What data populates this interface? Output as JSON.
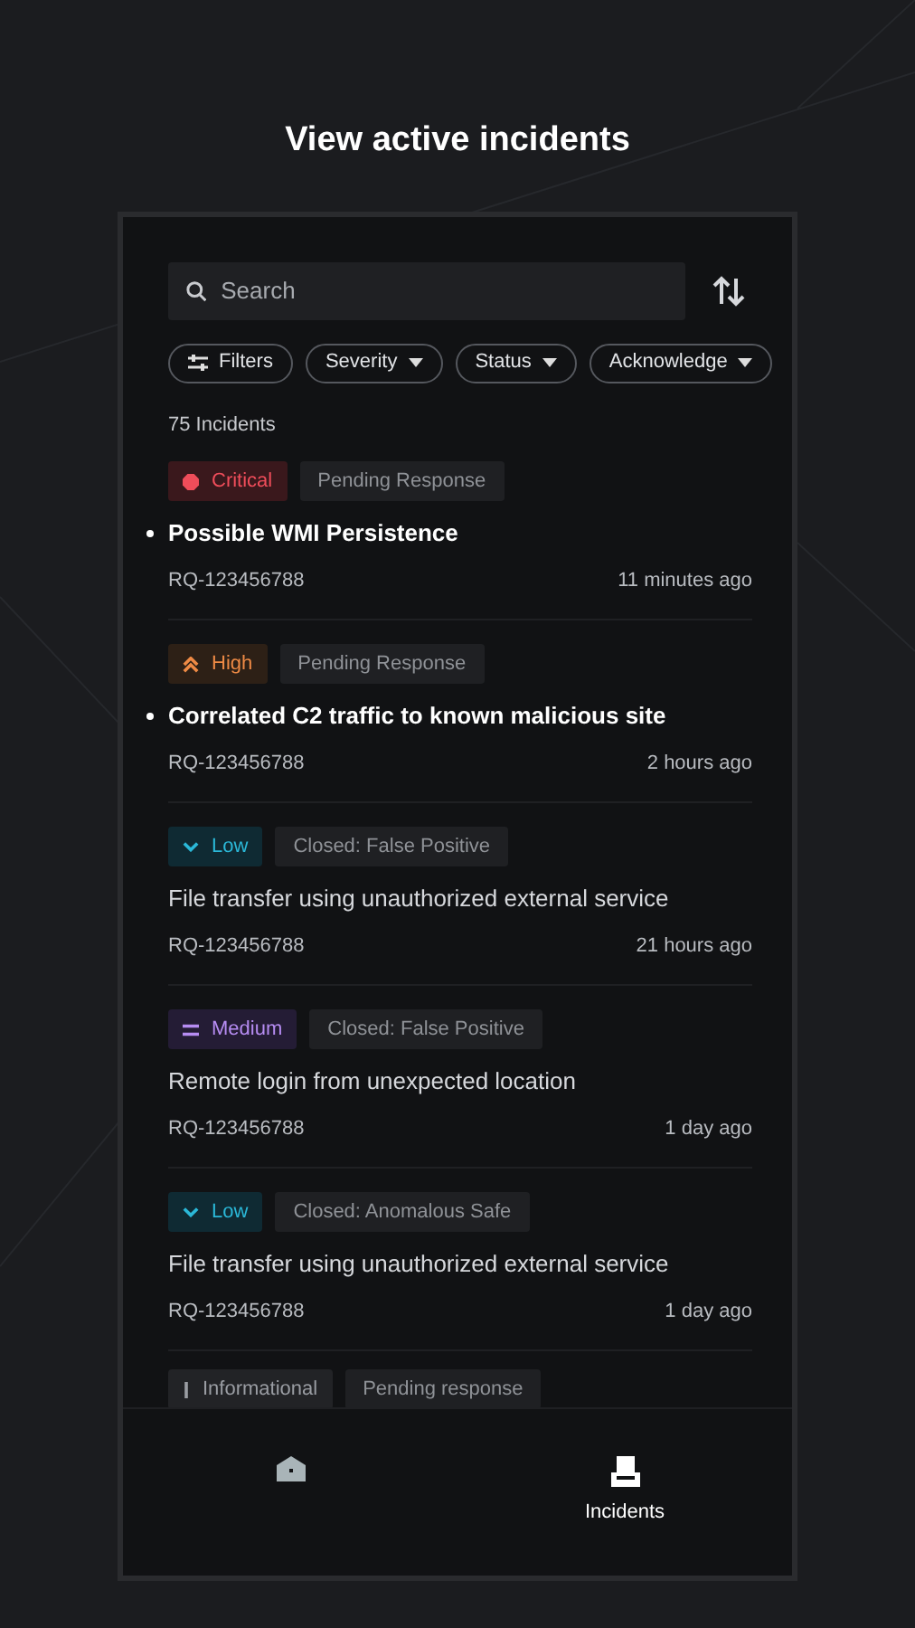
{
  "heading": "View active incidents",
  "search": {
    "placeholder": "Search"
  },
  "filters": [
    {
      "label": "Filters",
      "kind": "filter"
    },
    {
      "label": "Severity",
      "kind": "dropdown"
    },
    {
      "label": "Status",
      "kind": "dropdown"
    },
    {
      "label": "Acknowledge",
      "kind": "dropdown"
    }
  ],
  "count": "75 Incidents",
  "incidents": [
    {
      "severity": {
        "label": "Critical",
        "kind": "critical"
      },
      "status": "Pending Response",
      "title": "Possible WMI Persistence",
      "unread": true,
      "id": "RQ-123456788",
      "time": "11 minutes ago"
    },
    {
      "severity": {
        "label": "High",
        "kind": "high"
      },
      "status": "Pending Response",
      "title": "Correlated C2 traffic to known malicious site",
      "unread": true,
      "id": "RQ-123456788",
      "time": "2 hours ago"
    },
    {
      "severity": {
        "label": "Low",
        "kind": "low"
      },
      "status": "Closed: False Positive",
      "title": "File transfer using unauthorized external service",
      "unread": false,
      "id": "RQ-123456788",
      "time": "21 hours ago"
    },
    {
      "severity": {
        "label": "Medium",
        "kind": "medium"
      },
      "status": "Closed: False Positive",
      "title": "Remote login from unexpected location",
      "unread": false,
      "id": "RQ-123456788",
      "time": "1 day ago"
    },
    {
      "severity": {
        "label": "Low",
        "kind": "low"
      },
      "status": "Closed: Anomalous Safe",
      "title": "File transfer using unauthorized external service",
      "unread": false,
      "id": "RQ-123456788",
      "time": "1 day ago"
    }
  ],
  "partial_incident": {
    "severity": {
      "label": "Informational",
      "kind": "informational"
    },
    "status": "Pending response"
  },
  "nav": [
    {
      "kind": "home",
      "selected": false
    },
    {
      "kind": "incidents",
      "label": "Incidents",
      "selected": true
    }
  ]
}
